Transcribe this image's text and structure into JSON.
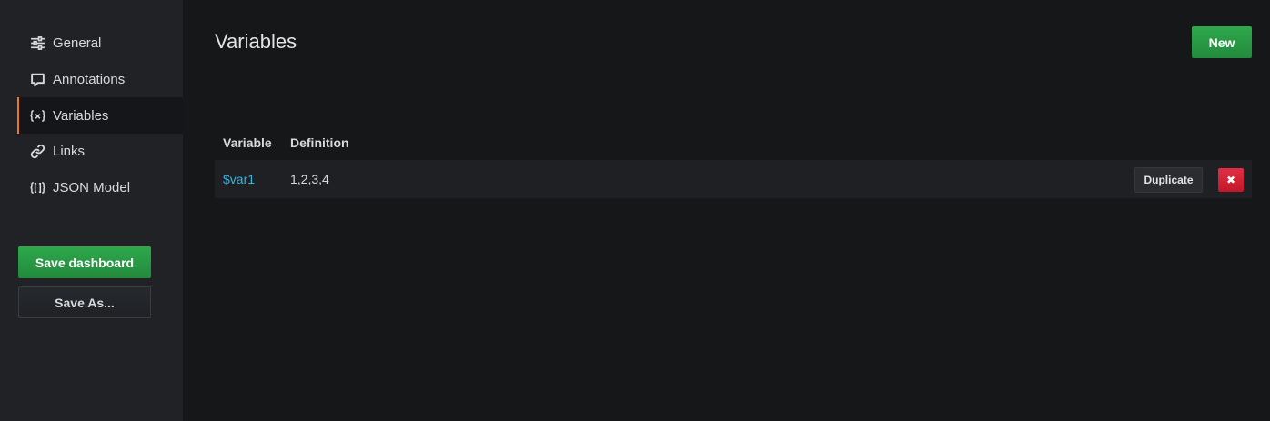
{
  "sidebar": {
    "items": [
      {
        "label": "General",
        "icon": "sliders-icon"
      },
      {
        "label": "Annotations",
        "icon": "comment-icon"
      },
      {
        "label": "Variables",
        "icon": "variable-icon",
        "active": true
      },
      {
        "label": "Links",
        "icon": "link-icon"
      },
      {
        "label": "JSON Model",
        "icon": "json-icon"
      }
    ],
    "save_label": "Save dashboard",
    "save_as_label": "Save As..."
  },
  "main": {
    "title": "Variables",
    "new_label": "New",
    "table": {
      "headers": [
        "Variable",
        "Definition"
      ],
      "rows": [
        {
          "variable": "$var1",
          "definition": "1,2,3,4",
          "duplicate_label": "Duplicate",
          "delete_label": "✖"
        }
      ]
    }
  },
  "colors": {
    "accent_active": "#eb7b18",
    "primary": "#299c46",
    "danger": "#e02f44",
    "link": "#33b5e5"
  }
}
